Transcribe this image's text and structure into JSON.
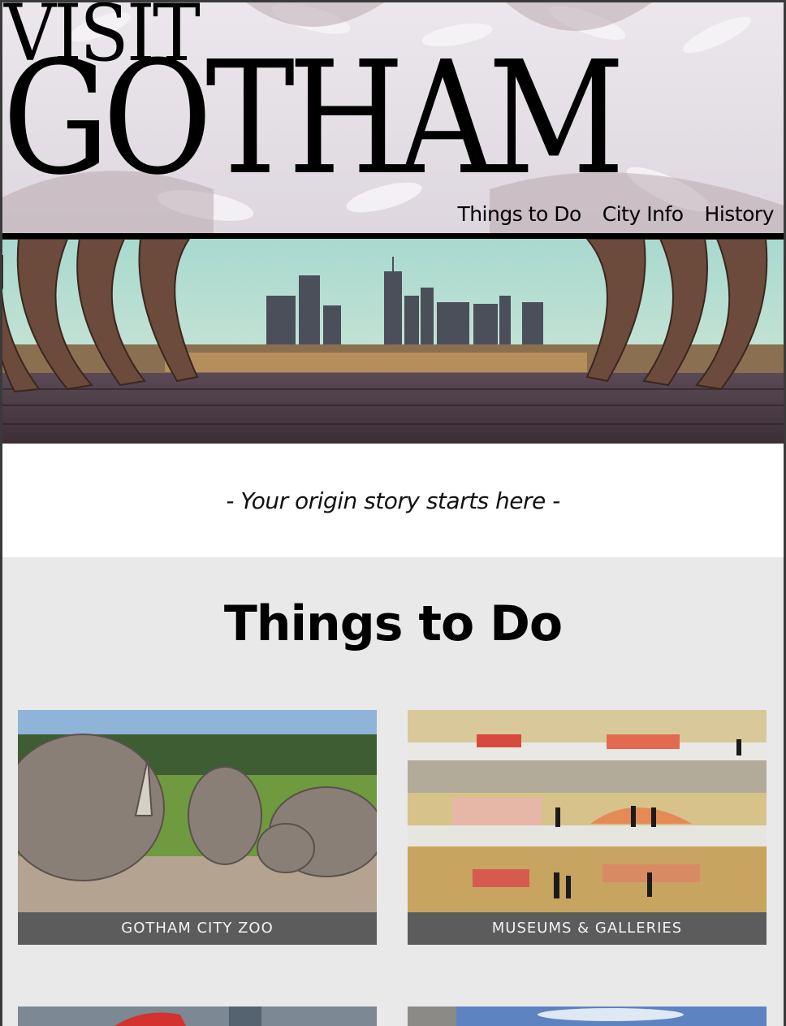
{
  "header": {
    "visit": "VISIT",
    "brand": "GOTHAM",
    "nav": [
      "Things to Do",
      "City Info",
      "History"
    ]
  },
  "hero": {
    "alt_icon": "city-skyline-image"
  },
  "tagline": "- Your origin story starts here -",
  "section": {
    "title": "Things to Do",
    "cards": [
      {
        "caption": "GOTHAM CITY ZOO",
        "icon": "rhino-photo"
      },
      {
        "caption": "MUSEUMS & GALLERIES",
        "icon": "museum-photo"
      }
    ]
  },
  "colors": {
    "caption_bg": "#5c5c5c",
    "section_bg": "#e9e9e9",
    "band_bg": "#ffffff"
  }
}
